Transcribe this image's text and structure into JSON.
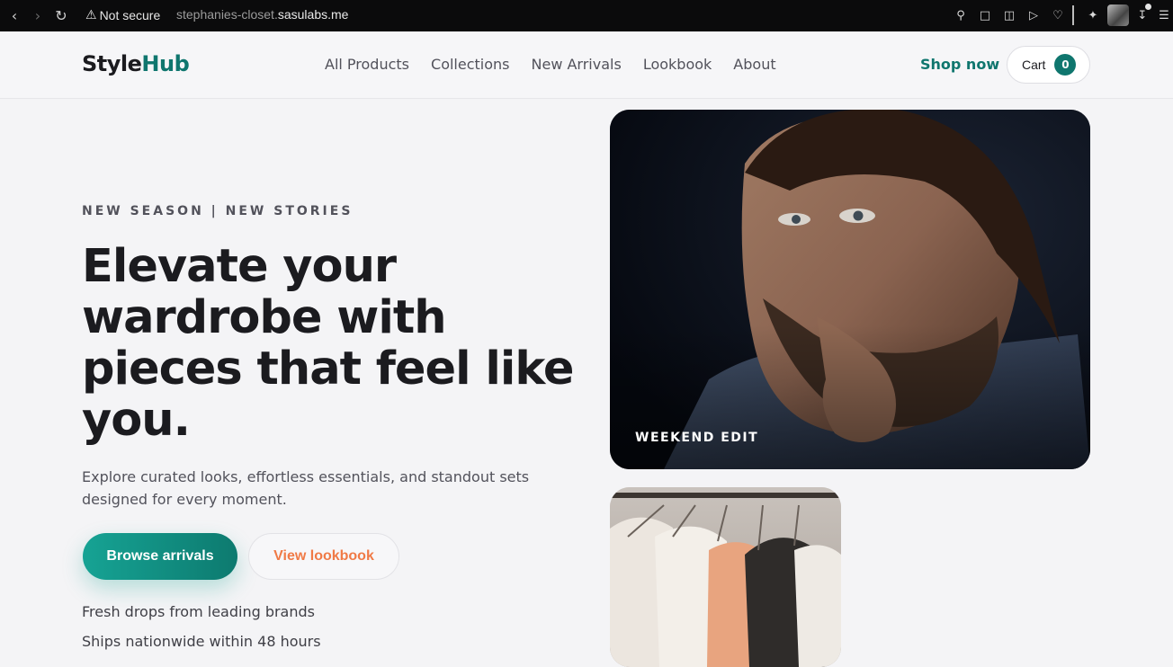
{
  "browser": {
    "security_label": "Not secure",
    "url_prefix": "stephanies-closet.",
    "url_domain": "sasulabs.me"
  },
  "header": {
    "logo_main": "Style",
    "logo_accent": "Hub",
    "nav": [
      "All Products",
      "Collections",
      "New Arrivals",
      "Lookbook",
      "About"
    ],
    "shop_now": "Shop now",
    "cart_label": "Cart",
    "cart_count": "0"
  },
  "hero": {
    "eyebrow": "NEW SEASON | NEW STORIES",
    "headline": "Elevate your wardrobe with pieces that feel like you.",
    "subtitle": "Explore curated looks, effortless essentials, and standout sets designed for every moment.",
    "primary_cta": "Browse arrivals",
    "secondary_cta": "View lookbook",
    "perks": [
      "Fresh drops from leading brands",
      "Ships nationwide within 48 hours"
    ]
  },
  "cards": {
    "main_label": "WEEKEND EDIT"
  },
  "colors": {
    "brand": "#0f766e",
    "accent": "#f07a46"
  }
}
